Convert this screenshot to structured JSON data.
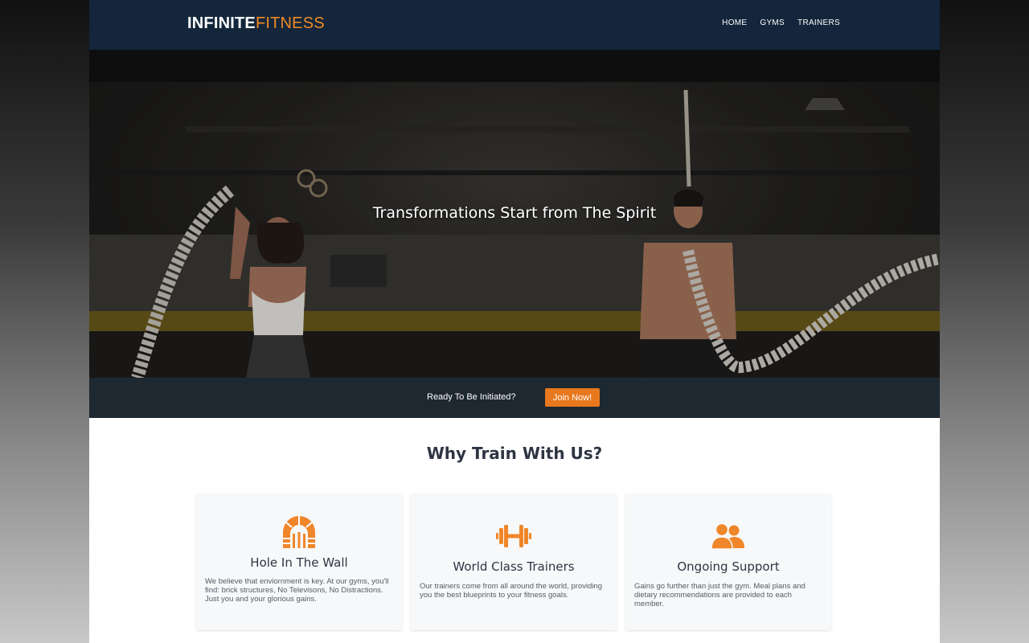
{
  "brand": {
    "name_main": "INFINITE",
    "name_accent": "FITNESS",
    "accent_color": "#f08a24"
  },
  "nav": {
    "items": [
      {
        "label": "HOME"
      },
      {
        "label": "GYMS"
      },
      {
        "label": "TRAINERS"
      }
    ]
  },
  "hero": {
    "title": "Transformations Start from The Spirit"
  },
  "cta": {
    "text": "Ready To Be Initiated?",
    "button_label": "Join Now!",
    "button_color": "#e8781e"
  },
  "features": {
    "title": "Why Train With Us?",
    "cards": [
      {
        "icon": "brick-archway-icon",
        "title": "Hole In The Wall",
        "text": "We believe that enviornment is key. At our gyms, you'll find: brick structures, No Televisons, No Distractions. Just you and your glorious gains."
      },
      {
        "icon": "dumbbell-icon",
        "title": "World Class Trainers",
        "text": "Our trainers come from all around the world, providing you the best blueprints to your fitness goals."
      },
      {
        "icon": "users-icon",
        "title": "Ongoing Support",
        "text": "Gains go further than just the gym. Meal plans and dietary recommendations are provided to each member."
      }
    ]
  }
}
